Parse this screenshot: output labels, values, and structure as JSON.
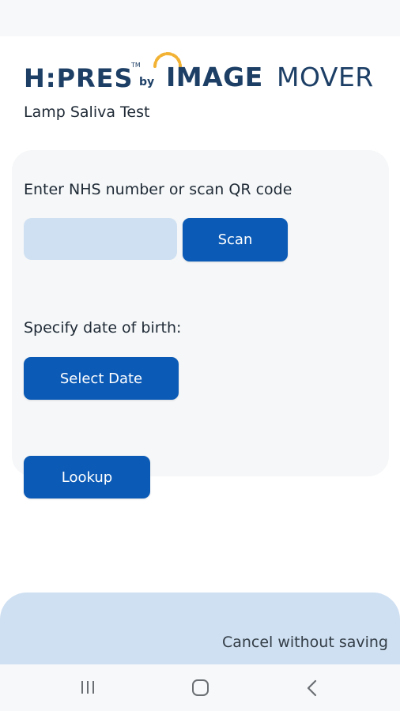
{
  "logo": {
    "part1": "H:PRES",
    "tm": "TM",
    "by": "by",
    "part2": "IMAGE",
    "part3": "MOVER",
    "arc_color": "#f2b234",
    "text_color": "#1d3f66"
  },
  "header": {
    "subtitle": "Lamp Saliva Test"
  },
  "form": {
    "nhs_prompt": "Enter NHS number or scan QR code",
    "nhs_value": "",
    "scan_label": "Scan",
    "dob_prompt": "Specify date of birth:",
    "select_date_label": "Select Date",
    "lookup_label": "Lookup"
  },
  "footer": {
    "cancel_label": "Cancel without saving"
  },
  "nav": {
    "recents_icon": "recents-icon",
    "home_icon": "home-icon",
    "back_icon": "back-icon"
  },
  "colors": {
    "primary_button": "#0b5ab6",
    "input_fill": "#cfe0f2",
    "card_bg": "#f5f7f8",
    "sheet_bg": "#cfe0f2"
  }
}
